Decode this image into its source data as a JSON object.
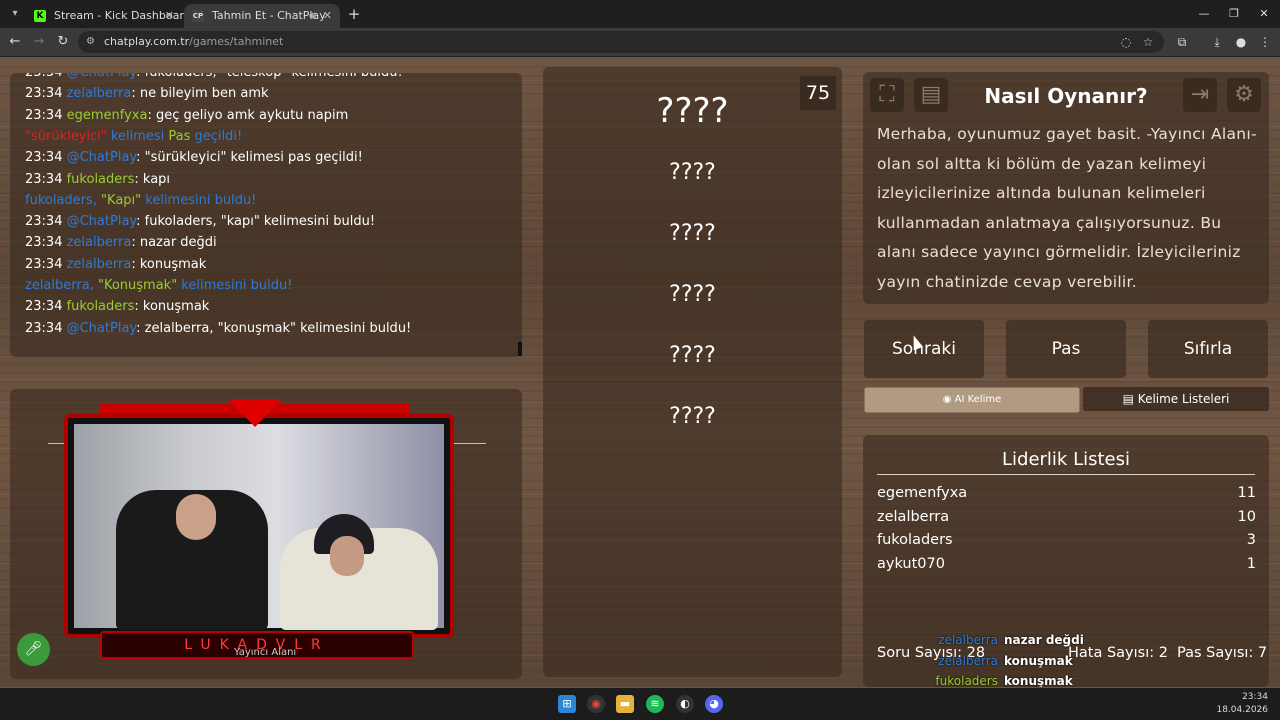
{
  "browser": {
    "tabs": [
      {
        "icon": "kick-icon",
        "title": "Stream - Kick Dashboard",
        "active": false
      },
      {
        "icon": "chatplay-icon",
        "title": "Tahmin Et - ChatPlay",
        "active": true
      }
    ],
    "url_domain": "chatplay.com.tr",
    "url_path": "/games/tahminet"
  },
  "chat": [
    {
      "time": "23:34",
      "user": "@ChatPlay",
      "user_color": "#2d7bd6",
      "parts": [
        {
          "t": ": fukoladers, \"teleskop\" kelimesini buldu!",
          "c": "#ffffff"
        }
      ]
    },
    {
      "time": "23:34",
      "user": "zelalberra",
      "user_color": "#2d7bd6",
      "parts": [
        {
          "t": ": ne bileyim ben amk",
          "c": "#ffffff"
        }
      ]
    },
    {
      "time": "23:34",
      "user": "egemenfyxa",
      "user_color": "#9acd32",
      "parts": [
        {
          "t": ": geç geliyo amk aykutu napim",
          "c": "#ffffff"
        }
      ]
    },
    {
      "time": "",
      "user": "",
      "user_color": "",
      "parts": [
        {
          "t": "\"sürükleyici\"",
          "c": "#e02020"
        },
        {
          "t": " kelimesi ",
          "c": "#2d7bd6"
        },
        {
          "t": "Pas",
          "c": "#9acd32"
        },
        {
          "t": " geçildi!",
          "c": "#2d7bd6"
        }
      ]
    },
    {
      "time": "23:34",
      "user": "@ChatPlay",
      "user_color": "#2d7bd6",
      "parts": [
        {
          "t": ": \"sürükleyici\" kelimesi pas geçildi!",
          "c": "#ffffff"
        }
      ]
    },
    {
      "time": "23:34",
      "user": "fukoladers",
      "user_color": "#9acd32",
      "parts": [
        {
          "t": ": kapı",
          "c": "#ffffff"
        }
      ]
    },
    {
      "time": "",
      "user": "",
      "user_color": "",
      "parts": [
        {
          "t": "fukoladers, ",
          "c": "#2d7bd6"
        },
        {
          "t": "\"Kapı\"",
          "c": "#9acd32"
        },
        {
          "t": " kelimesini buldu!",
          "c": "#2d7bd6"
        }
      ]
    },
    {
      "time": "23:34",
      "user": "@ChatPlay",
      "user_color": "#2d7bd6",
      "parts": [
        {
          "t": ": fukoladers, \"kapı\" kelimesini buldu!",
          "c": "#ffffff"
        }
      ]
    },
    {
      "time": "23:34",
      "user": "zelalberra",
      "user_color": "#2d7bd6",
      "parts": [
        {
          "t": ": nazar değdi",
          "c": "#ffffff"
        }
      ]
    },
    {
      "time": "23:34",
      "user": "zelalberra",
      "user_color": "#2d7bd6",
      "parts": [
        {
          "t": ": konuşmak",
          "c": "#ffffff"
        }
      ]
    },
    {
      "time": "",
      "user": "",
      "user_color": "",
      "parts": [
        {
          "t": "zelalberra, ",
          "c": "#2d7bd6"
        },
        {
          "t": "\"Konuşmak\"",
          "c": "#9acd32"
        },
        {
          "t": " kelimesini buldu!",
          "c": "#2d7bd6"
        }
      ]
    },
    {
      "time": "23:34",
      "user": "fukoladers",
      "user_color": "#9acd32",
      "parts": [
        {
          "t": ": konuşmak",
          "c": "#ffffff"
        }
      ]
    },
    {
      "time": "23:34",
      "user": "@ChatPlay",
      "user_color": "#2d7bd6",
      "parts": [
        {
          "t": ": zelalberra, \"konuşmak\" kelimesini buldu!",
          "c": "#ffffff"
        }
      ]
    }
  ],
  "camera": {
    "streamer_name": "LUKADVLR",
    "caption": "Yayıncı Alanı"
  },
  "game": {
    "timer": "75",
    "words": [
      "????",
      "????",
      "????",
      "????",
      "????",
      "????"
    ]
  },
  "howto": {
    "title": "Nasıl Oynanır?",
    "text": "Merhaba, oyunumuz gayet basit. -Yayıncı Alanı- olan sol altta ki bölüm de yazan kelimeyi izleyicilerinize altında bulunan kelimeleri kullanmadan anlatmaya çalışıyorsunuz. Bu alanı sadece yayıncı görmelidir. İzleyicileriniz yayın chatinizde cevap verebilir."
  },
  "actions": {
    "next": "Sonraki",
    "pass": "Pas",
    "reset": "Sıfırla",
    "ai_word": "AI Kelime",
    "word_lists": "Kelime Listeleri"
  },
  "leaderboard": {
    "title": "Liderlik Listesi",
    "rows": [
      {
        "name": "egemenfyxa",
        "score": "11"
      },
      {
        "name": "zelalberra",
        "score": "10"
      },
      {
        "name": "fukoladers",
        "score": "3"
      },
      {
        "name": "aykut070",
        "score": "1"
      }
    ],
    "stats": {
      "questions": "Soru Sayısı: 28",
      "errors": "Hata Sayısı: 2",
      "passes": "Pas Sayısı: 7"
    }
  },
  "chat_overlay": [
    {
      "user": "zelalberra",
      "user_color": "#2d7bd6",
      "message": "nazar değdi"
    },
    {
      "user": "zelalberra",
      "user_color": "#2d7bd6",
      "message": "konuşmak"
    },
    {
      "user": "fukoladers",
      "user_color": "#9acd32",
      "message": "konuşmak"
    },
    {
      "user": "@ChatPlay",
      "user_color": "#2d7bd6",
      "message": "zelalberra, \"konuşmak\" kelimesini buldu!"
    }
  ],
  "taskbar": {
    "time": "23:34",
    "date": "18.04.2026"
  }
}
